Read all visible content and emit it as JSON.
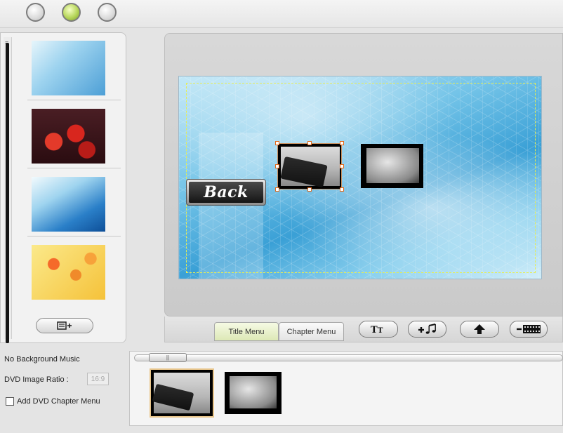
{
  "window_controls": [
    {
      "name": "control-1",
      "active": false
    },
    {
      "name": "control-2",
      "active": true
    },
    {
      "name": "control-3",
      "active": false
    }
  ],
  "templates": [
    {
      "name": "blue-ice",
      "colors": [
        "#b7e2f5",
        "#5aa9de"
      ]
    },
    {
      "name": "red-flowers",
      "colors": [
        "#3a0f12",
        "#c8241e"
      ]
    },
    {
      "name": "blue-wave",
      "colors": [
        "#d8eef8",
        "#1e78c4"
      ]
    },
    {
      "name": "yellow-flowers",
      "colors": [
        "#f7e07a",
        "#f0a02a"
      ]
    }
  ],
  "menu": {
    "back_label": "Back"
  },
  "tabs": {
    "title_menu": "Title Menu",
    "chapter_menu": "Chapter Menu"
  },
  "toolbar": {
    "text_icon": "text-icon",
    "music_icon": "add-music-icon",
    "up_icon": "up-arrow-icon",
    "film_icon": "remove-film-icon"
  },
  "settings": {
    "background_music": "No Background Music",
    "ratio_label": "DVD Image Ratio :",
    "ratio_value": "16:9",
    "chapter_menu_label": "Add DVD Chapter Menu",
    "chapter_menu_checked": false
  },
  "colors": {
    "accent_green": "#b6d65a",
    "selection_orange": "#e2691a",
    "safe_area_yellow": "#e8ee52"
  }
}
